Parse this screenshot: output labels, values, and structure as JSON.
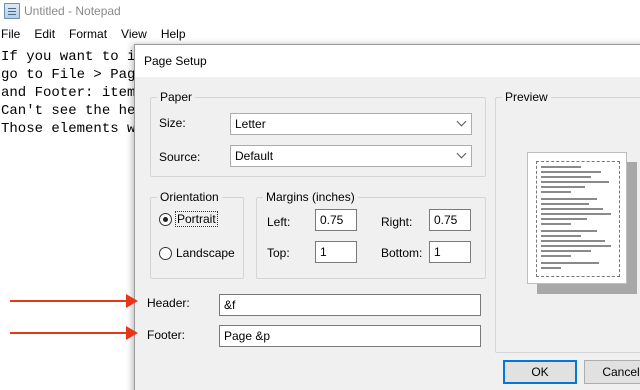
{
  "notepad": {
    "title": "Untitled - Notepad",
    "menu": [
      "File",
      "Edit",
      "Format",
      "View",
      "Help"
    ],
    "lines": [
      "If you want to in",
      "go to File > Page",
      "and Footer: items",
      "Can't see the hea",
      "Those elements wi"
    ]
  },
  "dialog": {
    "title": "Page Setup",
    "paper": {
      "legend": "Paper",
      "size_label": "Size:",
      "size_value": "Letter",
      "source_label": "Source:",
      "source_value": "Default"
    },
    "orientation": {
      "legend": "Orientation",
      "portrait": "Portrait",
      "landscape": "Landscape",
      "selected": "Portrait"
    },
    "margins": {
      "legend": "Margins (inches)",
      "left_label": "Left:",
      "left_value": "0.75",
      "right_label": "Right:",
      "right_value": "0.75",
      "top_label": "Top:",
      "top_value": "1",
      "bottom_label": "Bottom:",
      "bottom_value": "1"
    },
    "preview": {
      "label": "Preview"
    },
    "header": {
      "label": "Header:",
      "value": "&f"
    },
    "footer": {
      "label": "Footer:",
      "value": "Page &p"
    },
    "buttons": {
      "ok": "OK",
      "cancel": "Cancel"
    }
  },
  "colors": {
    "arrow": "#e8361a",
    "default_button_border": "#0078d7"
  }
}
